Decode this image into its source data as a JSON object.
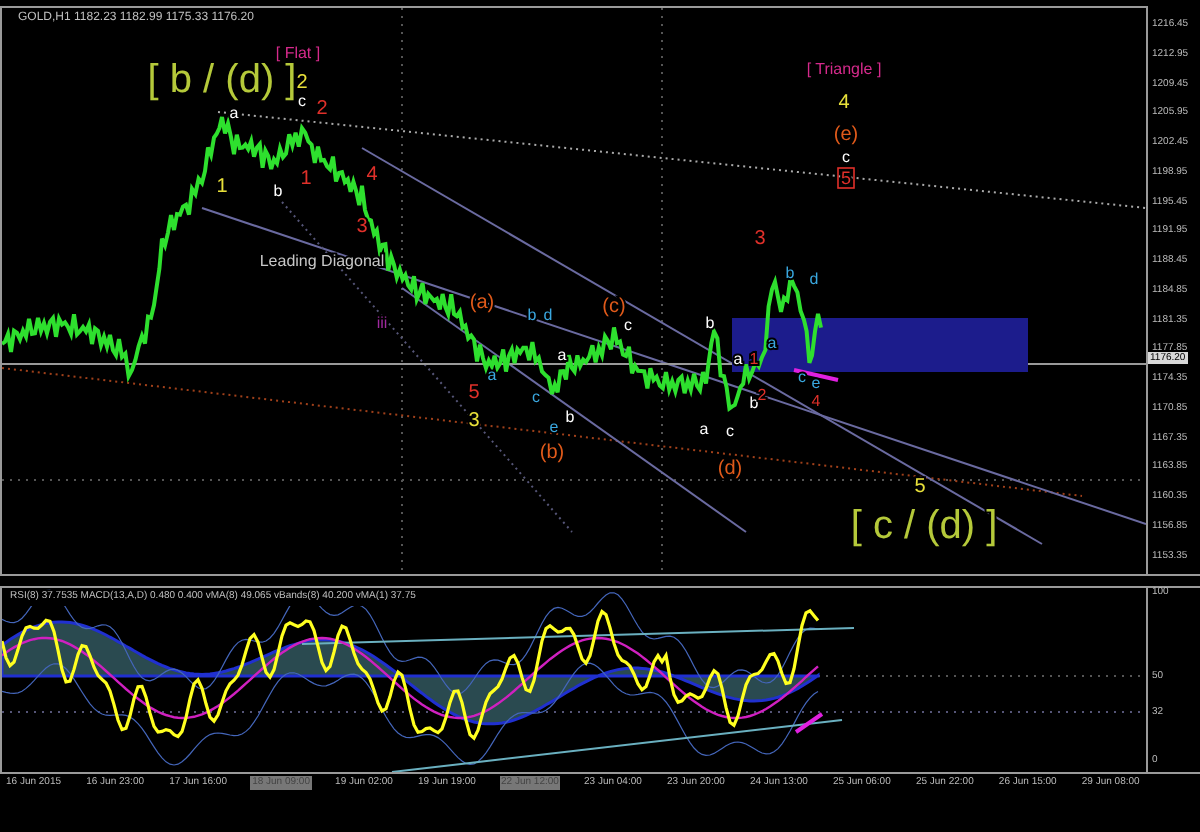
{
  "chart_header": "GOLD,H1  1182.23 1182.99 1175.33 1176.20",
  "price_axis": [
    "1216.45",
    "1212.95",
    "1209.45",
    "1205.95",
    "1202.45",
    "1198.95",
    "1195.45",
    "1191.95",
    "1188.45",
    "1184.85",
    "1181.35",
    "1177.85",
    "1174.35",
    "1170.85",
    "1167.35",
    "1163.85",
    "1160.35",
    "1156.85",
    "1153.35"
  ],
  "current_price": "1176.20",
  "wave_labels": [
    {
      "text": "[ b / (d) ]",
      "kind": "title",
      "color": "#b5c93a"
    },
    {
      "text": "[ Flat ]",
      "kind": "note",
      "color": "#d62a8c"
    },
    {
      "text": "2",
      "kind": "wave",
      "color": "#e8e03a"
    },
    {
      "text": "c",
      "kind": "small",
      "color": "#ffffff"
    },
    {
      "text": "2",
      "kind": "wave",
      "color": "#e0302a"
    },
    {
      "text": "a",
      "kind": "small",
      "color": "#ffffff"
    },
    {
      "text": "1",
      "kind": "wave",
      "color": "#e8e03a"
    },
    {
      "text": "b",
      "kind": "small",
      "color": "#ffffff"
    },
    {
      "text": "1",
      "kind": "wave",
      "color": "#e0302a"
    },
    {
      "text": "4",
      "kind": "wave",
      "color": "#e0302a"
    },
    {
      "text": "3",
      "kind": "wave",
      "color": "#e0302a"
    },
    {
      "text": "Leading Diagonal",
      "kind": "note",
      "color": "#c8c8c8"
    },
    {
      "text": "iii",
      "kind": "small",
      "color": "#a02aa0"
    },
    {
      "text": "(a)",
      "kind": "wave",
      "color": "#e05a1a"
    },
    {
      "text": "b",
      "kind": "small",
      "color": "#3aa8e0"
    },
    {
      "text": "d",
      "kind": "small",
      "color": "#3aa8e0"
    },
    {
      "text": "a",
      "kind": "small",
      "color": "#3aa8e0"
    },
    {
      "text": "5",
      "kind": "wave",
      "color": "#e0302a"
    },
    {
      "text": "3",
      "kind": "wave",
      "color": "#e8e03a"
    },
    {
      "text": "c",
      "kind": "small",
      "color": "#3aa8e0"
    },
    {
      "text": "a",
      "kind": "small",
      "color": "#ffffff"
    },
    {
      "text": "e",
      "kind": "small",
      "color": "#3aa8e0"
    },
    {
      "text": "b",
      "kind": "small",
      "color": "#ffffff"
    },
    {
      "text": "(b)",
      "kind": "wave",
      "color": "#e05a1a"
    },
    {
      "text": "(c)",
      "kind": "wave",
      "color": "#e05a1a"
    },
    {
      "text": "c",
      "kind": "small",
      "color": "#ffffff"
    },
    {
      "text": "b",
      "kind": "small",
      "color": "#ffffff"
    },
    {
      "text": "a",
      "kind": "small",
      "color": "#ffffff"
    },
    {
      "text": "1",
      "kind": "small",
      "color": "#e0302a"
    },
    {
      "text": "b",
      "kind": "small",
      "color": "#ffffff"
    },
    {
      "text": "2",
      "kind": "small",
      "color": "#e0302a"
    },
    {
      "text": "a",
      "kind": "small",
      "color": "#ffffff"
    },
    {
      "text": "c",
      "kind": "small",
      "color": "#ffffff"
    },
    {
      "text": "(d)",
      "kind": "wave",
      "color": "#e05a1a"
    },
    {
      "text": "[ Triangle ]",
      "kind": "note",
      "color": "#d62a8c"
    },
    {
      "text": "4",
      "kind": "wave",
      "color": "#e8e03a"
    },
    {
      "text": "(e)",
      "kind": "wave",
      "color": "#e05a1a"
    },
    {
      "text": "c",
      "kind": "small",
      "color": "#ffffff"
    },
    {
      "text": "5",
      "kind": "boxed",
      "color": "#e0302a"
    },
    {
      "text": "3",
      "kind": "wave",
      "color": "#e0302a"
    },
    {
      "text": "b",
      "kind": "small",
      "color": "#3aa8e0"
    },
    {
      "text": "d",
      "kind": "small",
      "color": "#3aa8e0"
    },
    {
      "text": "a",
      "kind": "small",
      "color": "#3aa8e0"
    },
    {
      "text": "c",
      "kind": "small",
      "color": "#3aa8e0"
    },
    {
      "text": "e",
      "kind": "small",
      "color": "#3aa8e0"
    },
    {
      "text": "4",
      "kind": "small",
      "color": "#e0302a"
    },
    {
      "text": "5",
      "kind": "wave",
      "color": "#e8e03a"
    },
    {
      "text": "[ c / (d) ]",
      "kind": "title",
      "color": "#b5c93a"
    }
  ],
  "indicator": {
    "header": "RSI(8) 37.7535  MACD(13,A,D) 0.480 0.400  vMA(8) 49.065  vBands(8) 40.200  vMA(1) 37.75",
    "axis": [
      "100",
      "50",
      "32",
      "0"
    ]
  },
  "time_axis": [
    {
      "label": "16 Jun 2015",
      "selected": false
    },
    {
      "label": "16 Jun 23:00",
      "selected": false
    },
    {
      "label": "17 Jun 16:00",
      "selected": false
    },
    {
      "label": "18 Jun 09:00",
      "selected": true
    },
    {
      "label": "19 Jun 02:00",
      "selected": false
    },
    {
      "label": "19 Jun 19:00",
      "selected": false
    },
    {
      "label": "22 Jun 12:00",
      "selected": true
    },
    {
      "label": "23 Jun 04:00",
      "selected": false
    },
    {
      "label": "23 Jun 20:00",
      "selected": false
    },
    {
      "label": "24 Jun 13:00",
      "selected": false
    },
    {
      "label": "25 Jun 06:00",
      "selected": false
    },
    {
      "label": "25 Jun 22:00",
      "selected": false
    },
    {
      "label": "26 Jun 15:00",
      "selected": false
    },
    {
      "label": "29 Jun 08:00",
      "selected": false
    }
  ]
}
